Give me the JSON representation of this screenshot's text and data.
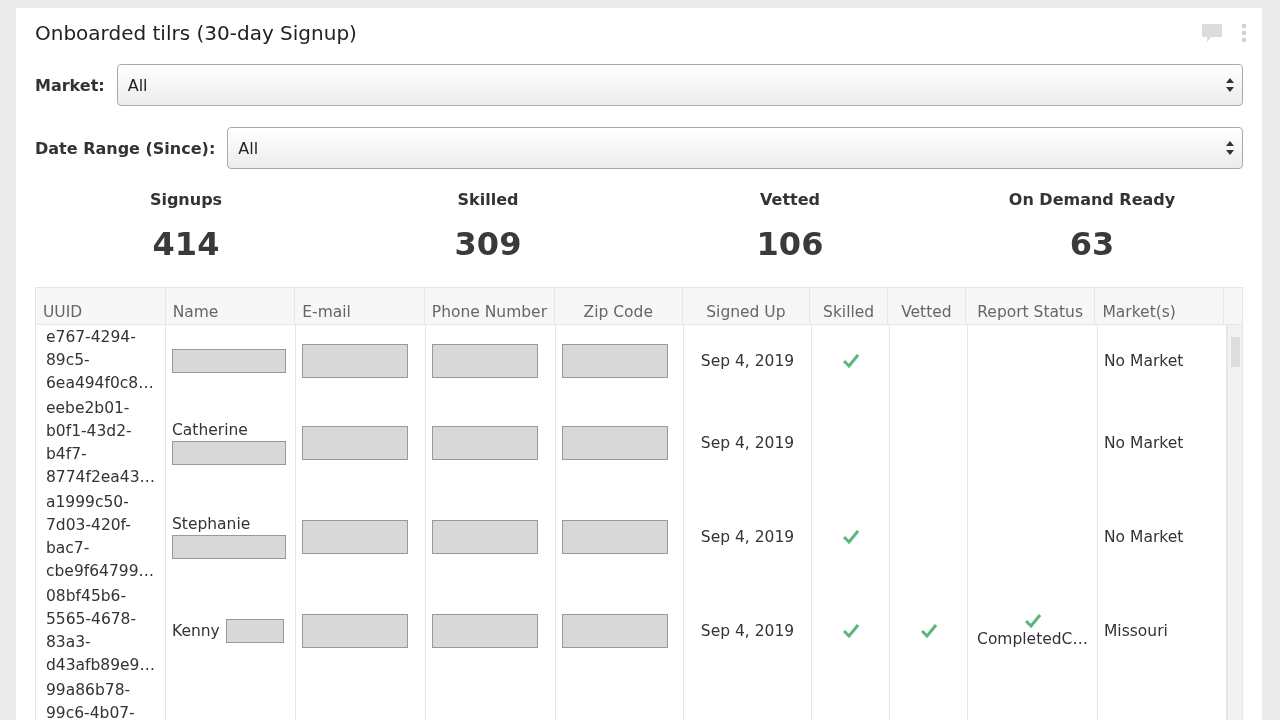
{
  "card": {
    "title": "Onboarded tilrs (30-day Signup)"
  },
  "filters": [
    {
      "label": "Market:",
      "value": "All"
    },
    {
      "label": "Date Range (Since):",
      "value": "All"
    }
  ],
  "stats": [
    {
      "label": "Signups",
      "value": "414"
    },
    {
      "label": "Skilled",
      "value": "309"
    },
    {
      "label": "Vetted",
      "value": "106"
    },
    {
      "label": "On Demand Ready",
      "value": "63"
    }
  ],
  "table": {
    "columns": [
      "UUID",
      "Name",
      "E-mail",
      "Phone Number",
      "Zip Code",
      "Signed Up",
      "Skilled",
      "Vetted",
      "Report Status",
      "Market(s)"
    ],
    "rows": [
      {
        "uuid": [
          "e767-4294-",
          "89c5-",
          "6ea494f0c8…"
        ],
        "name": "",
        "name_redacted": true,
        "email_redacted": true,
        "phone_redacted": true,
        "zip_redacted": true,
        "signed_up": "Sep 4, 2019",
        "skilled": true,
        "vetted": false,
        "report_status": "",
        "report_done": false,
        "market": "No Market"
      },
      {
        "uuid": [
          "eebe2b01-",
          "b0f1-43d2-",
          "b4f7-",
          "8774f2ea43…"
        ],
        "name": "Catherine",
        "name_redacted": true,
        "email_redacted": true,
        "phone_redacted": true,
        "zip_redacted": true,
        "signed_up": "Sep 4, 2019",
        "skilled": false,
        "vetted": false,
        "report_status": "",
        "report_done": false,
        "market": "No Market"
      },
      {
        "uuid": [
          "a1999c50-",
          "7d03-420f-",
          "bac7-",
          "cbe9f64799…"
        ],
        "name": "Stephanie",
        "name_redacted": true,
        "email_redacted": true,
        "phone_redacted": true,
        "zip_redacted": true,
        "signed_up": "Sep 4, 2019",
        "skilled": true,
        "vetted": false,
        "report_status": "",
        "report_done": false,
        "market": "No Market"
      },
      {
        "uuid": [
          "08bf45b6-",
          "5565-4678-",
          "83a3-",
          "d43afb89e9…"
        ],
        "name": "Kenny",
        "name_redacted": true,
        "email_redacted": true,
        "phone_redacted": true,
        "zip_redacted": true,
        "signed_up": "Sep 4, 2019",
        "skilled": true,
        "vetted": true,
        "report_status": "CompletedC…",
        "report_done": true,
        "market": "Missouri"
      },
      {
        "uuid": [
          "99a86b78-",
          "99c6-4b07-"
        ]
      }
    ]
  }
}
